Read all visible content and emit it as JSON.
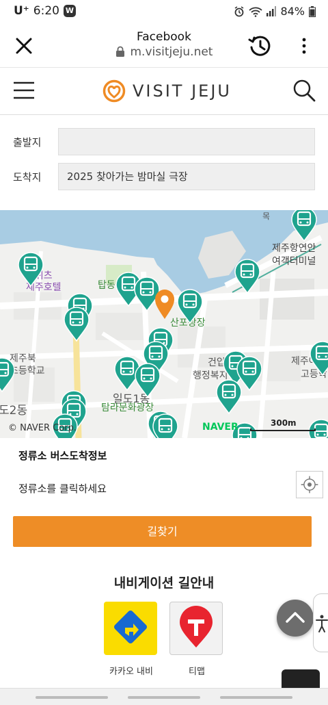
{
  "status_bar": {
    "carrier": "U⁺",
    "time": "6:20",
    "app_badge": "W",
    "battery": "84%"
  },
  "browser_bar": {
    "title": "Facebook",
    "url": "m.visitjeju.net"
  },
  "site_header": {
    "logo_text": "VISIT JEJU"
  },
  "route_form": {
    "origin_label": "출발지",
    "origin_value": "",
    "destination_label": "도착지",
    "destination_value": "2025 찾아가는 밤마실 극장"
  },
  "map": {
    "labels": {
      "hotel": "스위츠\n제주호텔",
      "port_terminal_1": "제주항연안",
      "port_terminal_2": "여객터미널",
      "tapdong": "탑동",
      "sanpo": "산포광장",
      "school_1": "제주북",
      "school_2": "초등학교",
      "geonip_1": "건입",
      "geonip_2": "행정복지",
      "high_1": "제주여",
      "high_2": "고등학",
      "ildo": "일도1동",
      "tamla": "탐라문화광장",
      "dong2": "도2동",
      "mok": "목"
    },
    "copyright": "© NAVER Corp.",
    "brand": "NAVER",
    "scale_label": "300m",
    "colors": {
      "bus_marker": "#1fa38e",
      "destination_marker": "#ef8b24",
      "sea": "#a8cce3",
      "road": "#ffffff",
      "park": "#d7ebc7"
    }
  },
  "stop_info": {
    "title": "정류소 버스도착정보",
    "message": "정류소를 클릭하세요"
  },
  "route_button": "길찾기",
  "navigation": {
    "title": "내비게이션 길안내",
    "apps": [
      {
        "label": "카카오 내비",
        "color": "#fadc00"
      },
      {
        "label": "티맵",
        "color": "#f2f2f2"
      }
    ]
  },
  "colors": {
    "accent": "#ee8d26"
  }
}
